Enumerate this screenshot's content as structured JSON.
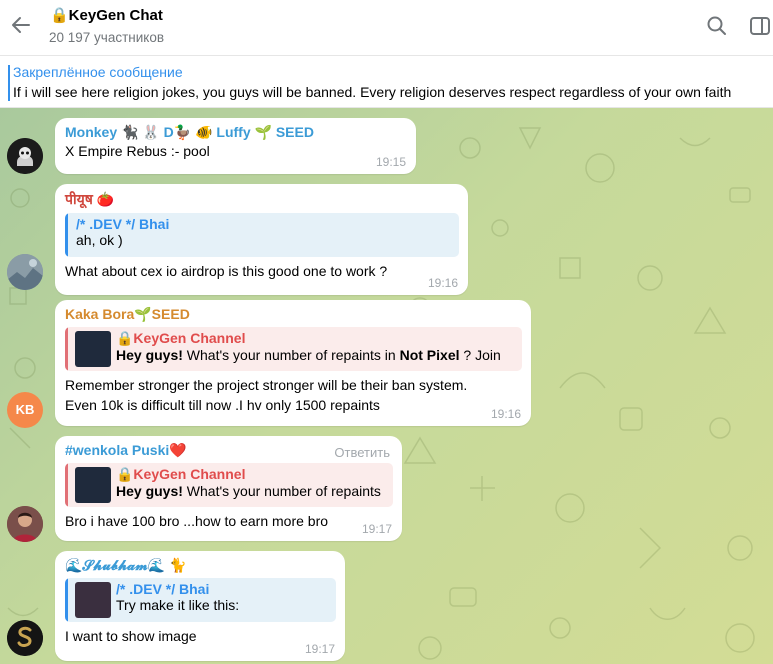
{
  "header": {
    "title": "🔒KeyGen Chat",
    "subtitle": "20 197 участников"
  },
  "pinned": {
    "title": "Закреплённое сообщение",
    "text": "If i will see here religion jokes, you guys will be banned.   Every religion deserves respect regardless of your own faith"
  },
  "messages": [
    {
      "sender": "Monkey 🐈‍⬛ 🐰 D🦆 🐠 Luffy 🌱 SEED",
      "sender_color": "#3b9bd6",
      "text": "X Empire Rebus :- pool",
      "time": "19:15",
      "avatar": "skull"
    },
    {
      "sender": "पीयूष 🍅",
      "sender_color": "#d0473d",
      "quote_name": "/* .DEV */ Bhai",
      "quote_text": "ah, ok )",
      "text": "What about cex io airdrop is this good one to work ?",
      "time": "19:16",
      "avatar": "photo"
    },
    {
      "sender": "Kaka Bora🌱SEED",
      "sender_color": "#d58a2e",
      "quote_name": "🔒KeyGen Channel",
      "quote_text_bold": "Hey guys!",
      "quote_text": "  What's your number of repaints in ",
      "quote_text_bold2": "Not Pixel",
      "quote_text2": " ? Join",
      "text_lines": [
        "Remember stronger the project stronger will be their ban system.",
        "Even 10k is difficult till now .I hv only 1500 repaints"
      ],
      "time": "19:16",
      "avatar_initials": "KB",
      "avatar_color": "#f5884a"
    },
    {
      "sender": "#wenkola Puski❤️",
      "sender_color": "#3b9bd6",
      "reply_label": "Ответить",
      "quote_name": "🔒KeyGen Channel",
      "quote_text_bold": "Hey guys!",
      "quote_text": "  What's your number of repaints",
      "text": "Bro i have 100 bro ...how to earn more bro",
      "time": "19:17",
      "avatar": "person"
    },
    {
      "sender": "🌊𝓢𝓱𝓾𝓫𝓱𝓪𝓶🌊 🐈",
      "sender_color": "#3b9bd6",
      "quote_name": "/* .DEV */ Bhai",
      "quote_text": "Try make it like this:",
      "text": "I want to show image",
      "time": "19:17",
      "avatar": "gold"
    }
  ]
}
